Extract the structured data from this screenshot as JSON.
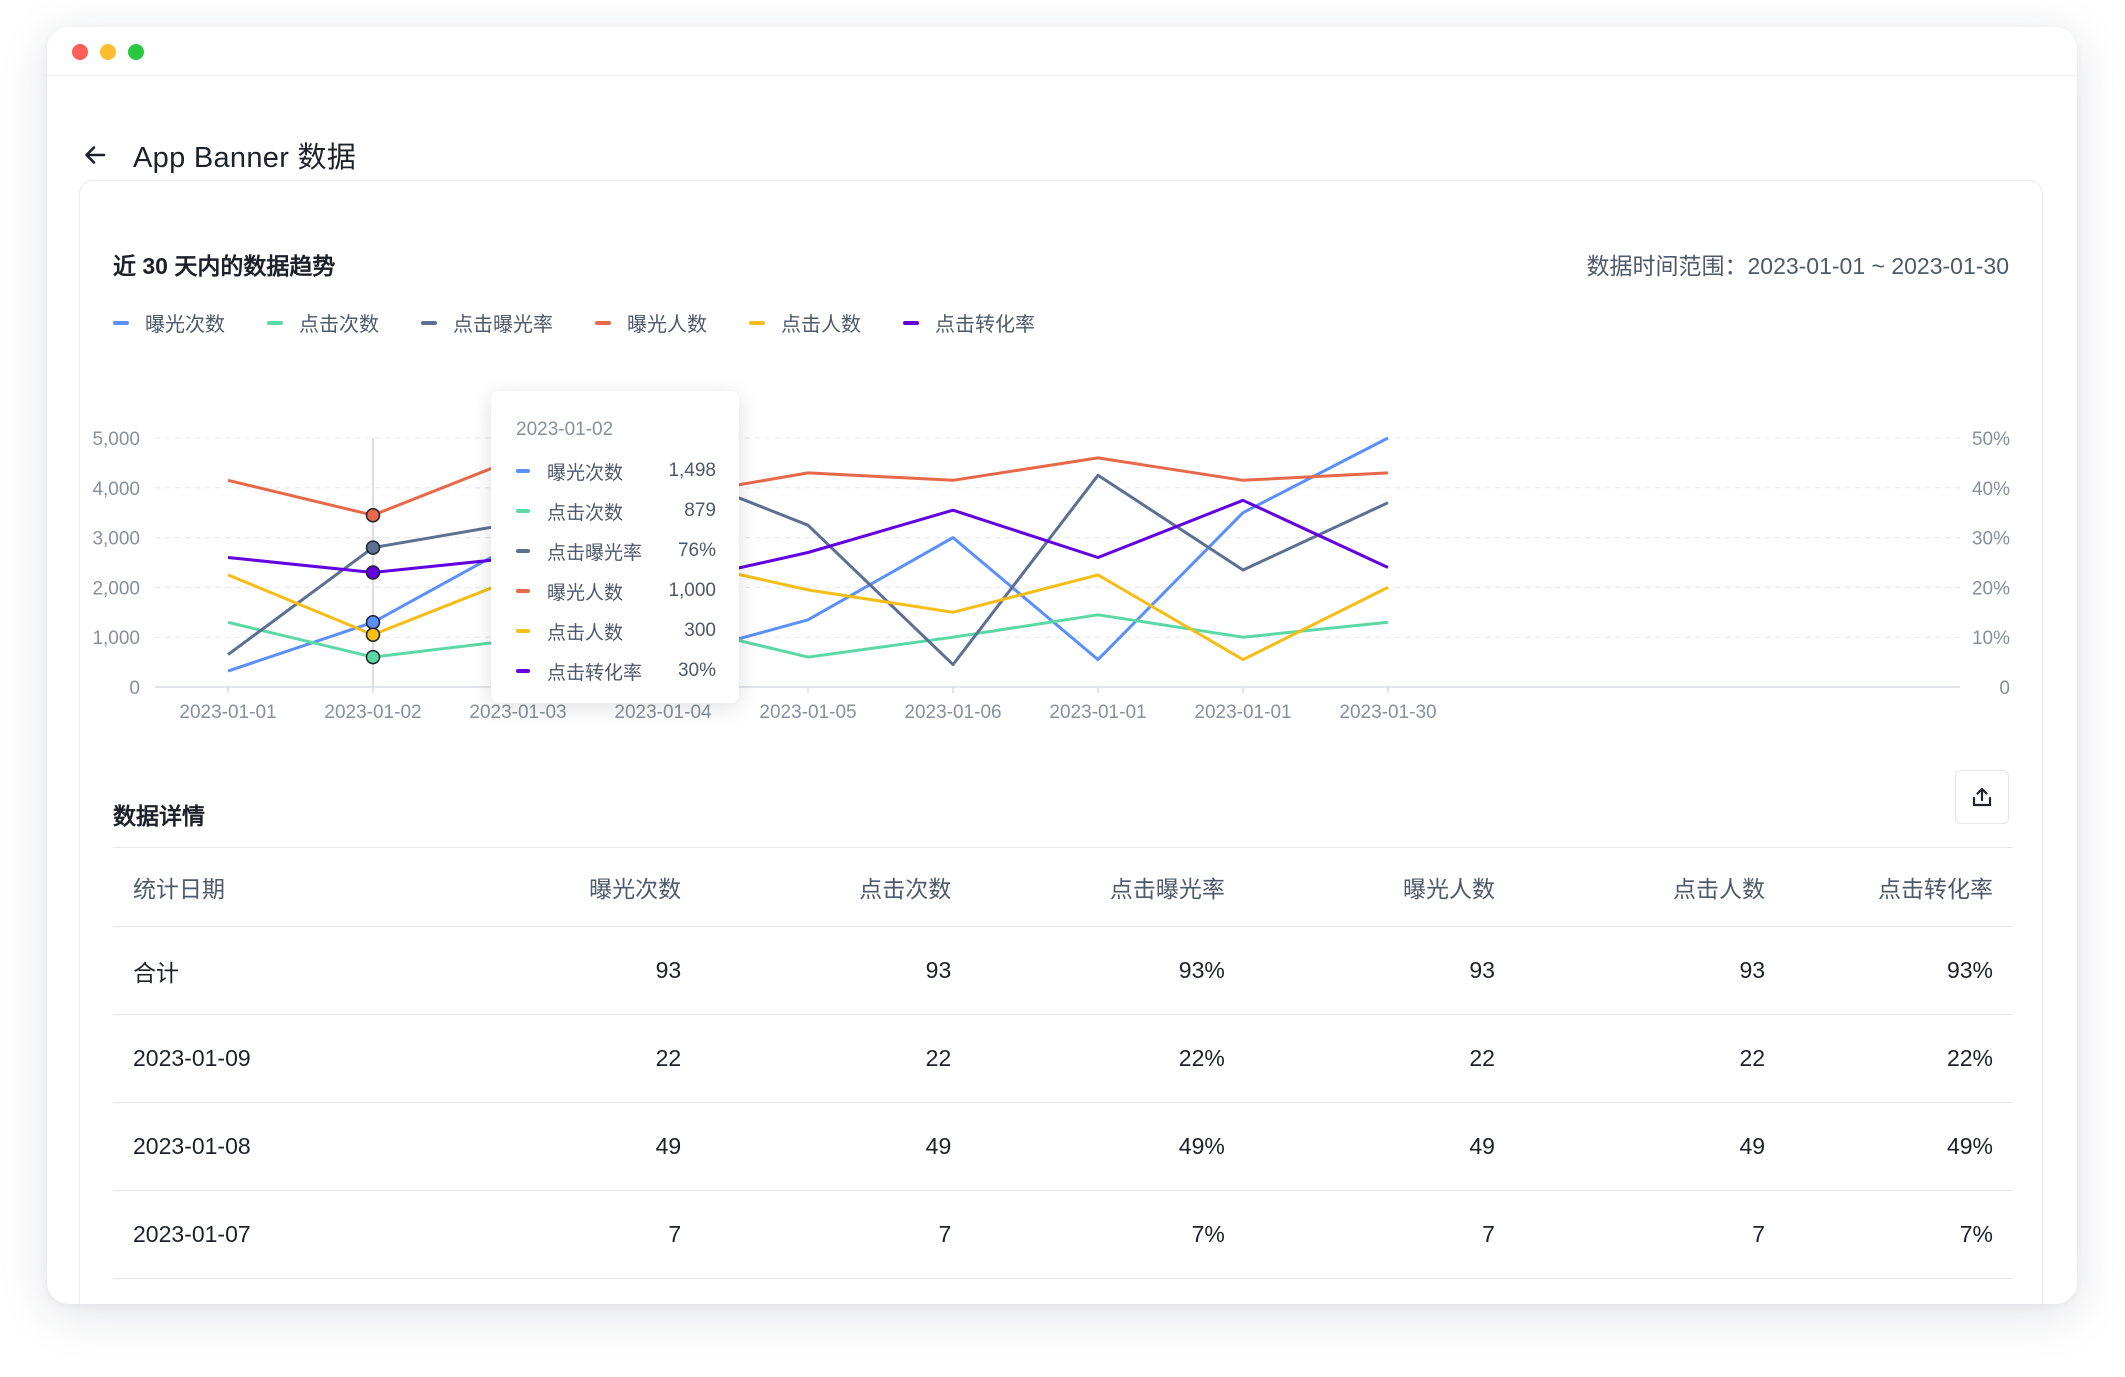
{
  "page": {
    "title": "App Banner 数据"
  },
  "chart_card": {
    "title": "近 30 天内的数据趋势",
    "range_label": "数据时间范围：",
    "range_value": "2023-01-01 ~ 2023-01-30"
  },
  "legend": [
    {
      "label": "曝光次数",
      "color": "#5b8ff9"
    },
    {
      "label": "点击次数",
      "color": "#5ad8a6"
    },
    {
      "label": "点击曝光率",
      "color": "#5d7092"
    },
    {
      "label": "曝光人数",
      "color": "#e8684a"
    },
    {
      "label": "点击人数",
      "color": "#f6bd16"
    },
    {
      "label": "点击转化率",
      "color": "#6200e0"
    }
  ],
  "chart_data": {
    "type": "line",
    "categories": [
      "2023-01-01",
      "2023-01-02",
      "2023-01-03",
      "2023-01-04",
      "2023-01-05",
      "2023-01-06",
      "2023-01-01",
      "2023-01-01",
      "2023-01-30"
    ],
    "left_axis": {
      "ticks": [
        "0",
        "1,000",
        "2,000",
        "3,000",
        "4,000",
        "5,000"
      ],
      "ylim": [
        0,
        5000
      ]
    },
    "right_axis": {
      "ticks": [
        "0",
        "10%",
        "20%",
        "30%",
        "40%",
        "50%"
      ],
      "ylim": [
        0,
        50
      ]
    },
    "grid": true,
    "series": [
      {
        "name": "曝光次数",
        "axis": "left",
        "color": "#5b8ff9",
        "values": [
          320,
          1300,
          2900,
          550,
          1350,
          3000,
          550,
          3500,
          5000
        ]
      },
      {
        "name": "点击次数",
        "axis": "left",
        "color": "#5ad8a6",
        "values": [
          1300,
          600,
          950,
          1300,
          600,
          1000,
          1450,
          1000,
          1300
        ]
      },
      {
        "name": "点击曝光率",
        "axis": "right",
        "color": "#5d7092",
        "values": [
          6.5,
          28,
          33,
          44,
          32.5,
          4.5,
          42.5,
          23.5,
          37
        ]
      },
      {
        "name": "曝光人数",
        "axis": "left",
        "color": "#e8684a",
        "values": [
          4150,
          3450,
          4600,
          3800,
          4300,
          4150,
          4600,
          4150,
          4300
        ]
      },
      {
        "name": "点击人数",
        "axis": "left",
        "color": "#f6bd16",
        "values": [
          2250,
          1050,
          2200,
          2600,
          1950,
          1500,
          2250,
          550,
          2000
        ]
      },
      {
        "name": "点击转化率",
        "axis": "right",
        "color": "#6200e0",
        "values": [
          26,
          23,
          26,
          20.5,
          27,
          35.5,
          26,
          37.5,
          24
        ]
      }
    ],
    "highlight_index": 1,
    "tooltip": {
      "date": "2023-01-02",
      "rows": [
        {
          "name": "曝光次数",
          "value": "1,498",
          "color": "#5b8ff9"
        },
        {
          "name": "点击次数",
          "value": "879",
          "color": "#5ad8a6"
        },
        {
          "name": "点击曝光率",
          "value": "76%",
          "color": "#5d7092"
        },
        {
          "name": "曝光人数",
          "value": "1,000",
          "color": "#e8684a"
        },
        {
          "name": "点击人数",
          "value": "300",
          "color": "#f6bd16"
        },
        {
          "name": "点击转化率",
          "value": "30%",
          "color": "#6200e0"
        }
      ]
    }
  },
  "details": {
    "title": "数据详情",
    "export_icon": "export-icon",
    "columns": [
      "统计日期",
      "曝光次数",
      "点击次数",
      "点击曝光率",
      "曝光人数",
      "点击人数",
      "点击转化率"
    ],
    "rows": [
      [
        "合计",
        "93",
        "93",
        "93%",
        "93",
        "93",
        "93%"
      ],
      [
        "2023-01-09",
        "22",
        "22",
        "22%",
        "22",
        "22",
        "22%"
      ],
      [
        "2023-01-08",
        "49",
        "49",
        "49%",
        "49",
        "49",
        "49%"
      ],
      [
        "2023-01-07",
        "7",
        "7",
        "7%",
        "7",
        "7",
        "7%"
      ]
    ]
  }
}
